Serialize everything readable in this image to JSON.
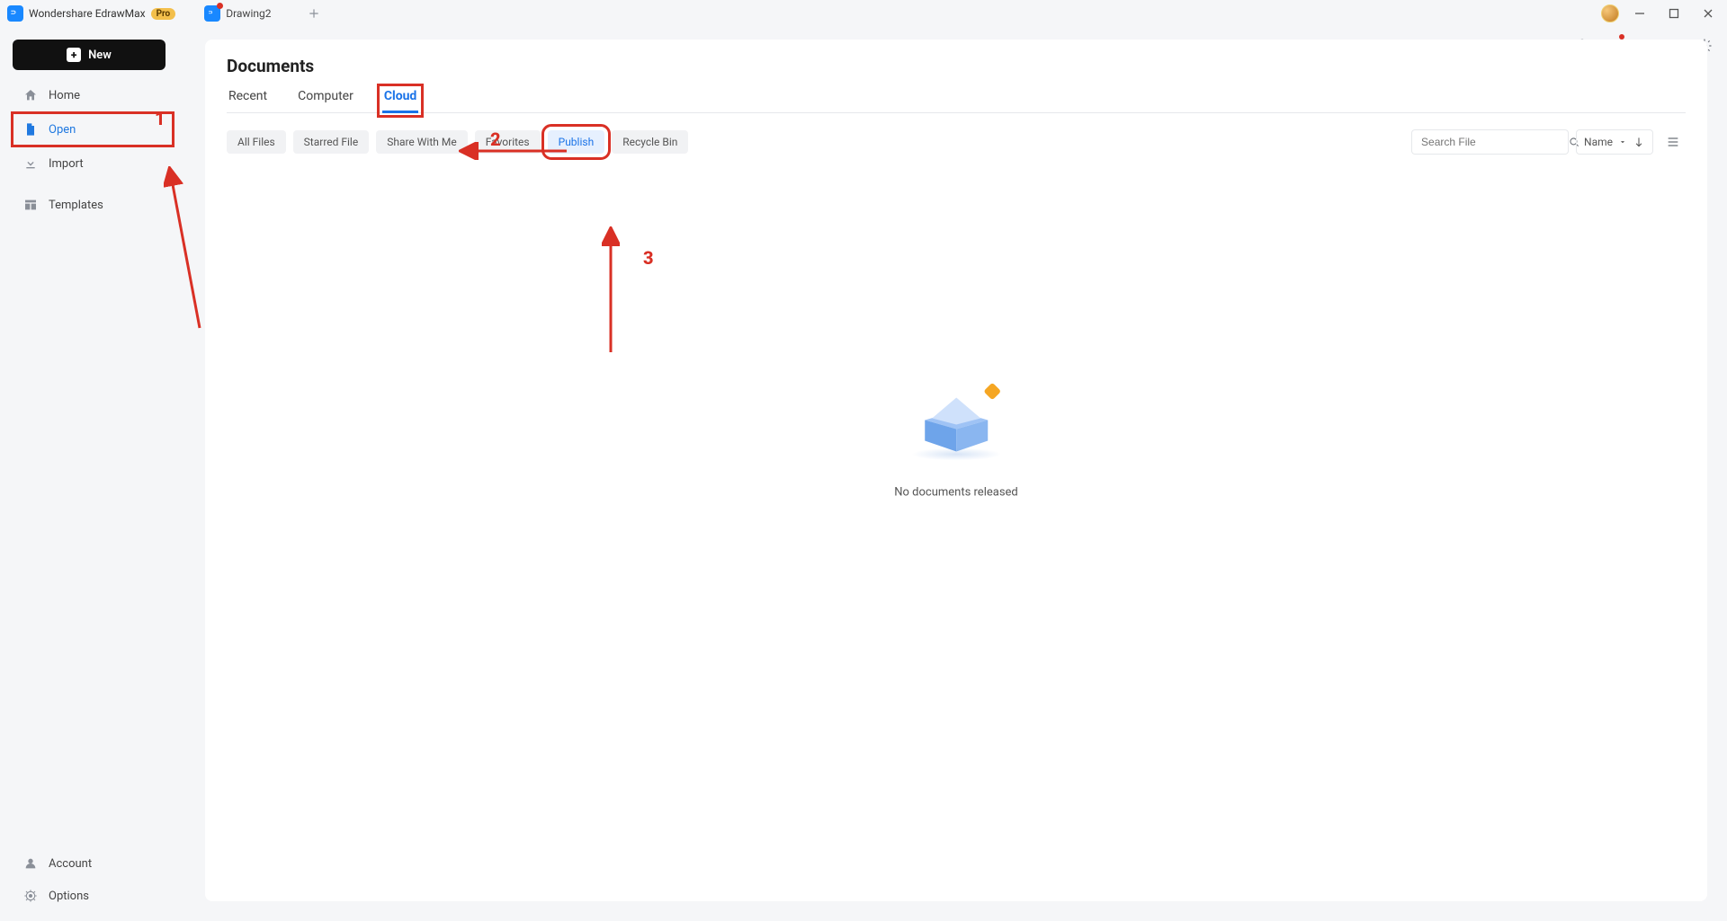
{
  "titlebar": {
    "app_name": "Wondershare EdrawMax",
    "pro_label": "Pro",
    "doc_tab_label": "Drawing2"
  },
  "sidebar": {
    "new_label": "New",
    "items": [
      {
        "label": "Home"
      },
      {
        "label": "Open"
      },
      {
        "label": "Import"
      },
      {
        "label": "Templates"
      }
    ],
    "bottom_items": [
      {
        "label": "Account"
      },
      {
        "label": "Options"
      }
    ]
  },
  "page": {
    "title": "Documents",
    "tabs": [
      {
        "label": "Recent"
      },
      {
        "label": "Computer"
      },
      {
        "label": "Cloud"
      }
    ],
    "filters": [
      {
        "label": "All Files"
      },
      {
        "label": "Starred File"
      },
      {
        "label": "Share With Me"
      },
      {
        "label": "Favorites"
      },
      {
        "label": "Publish"
      },
      {
        "label": "Recycle Bin"
      }
    ],
    "search_placeholder": "Search File",
    "sort_label": "Name",
    "empty_text": "No documents released"
  },
  "annotations": {
    "n1": "1",
    "n2": "2",
    "n3": "3"
  }
}
